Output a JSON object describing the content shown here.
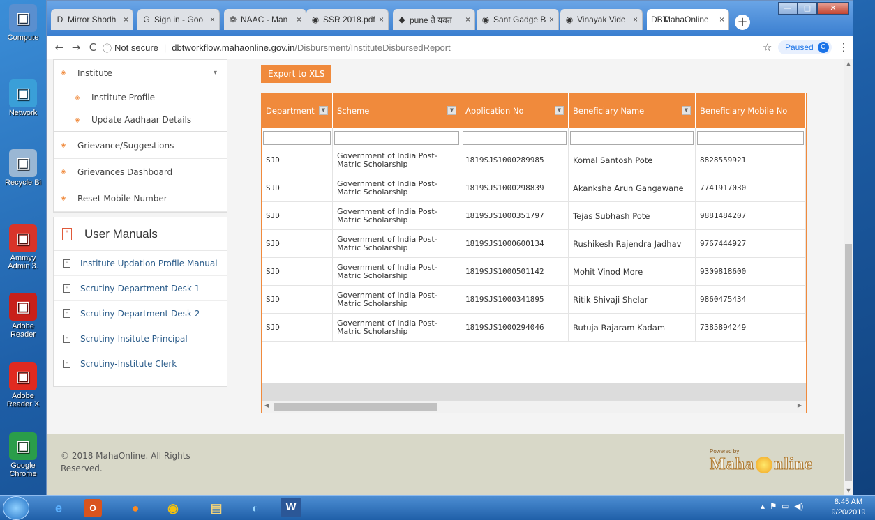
{
  "desktop": {
    "icons": [
      {
        "label": "Compute",
        "icon": "computer-icon",
        "color": "#5a8fcf"
      },
      {
        "label": "Network",
        "icon": "network-icon",
        "color": "#3a9fd8"
      },
      {
        "label": "Recycle Bi",
        "icon": "recycle-bin-icon",
        "color": "#9ab7d4"
      },
      {
        "label": "Ammyy Admin 3.",
        "icon": "ammyy-admin-icon",
        "color": "#d8342a"
      },
      {
        "label": "Adobe Reader",
        "icon": "adobe-reader-icon",
        "color": "#c8201a"
      },
      {
        "label": "Adobe Reader X",
        "icon": "adobe-reader-x-icon",
        "color": "#e02a20"
      },
      {
        "label": "Google Chrome",
        "icon": "chrome-icon",
        "color": "#2a9d4a"
      }
    ]
  },
  "browser": {
    "tabs": [
      {
        "label": "Mirror Shodh",
        "icon": "D"
      },
      {
        "label": "Sign in - Goo",
        "icon": "G"
      },
      {
        "label": "NAAC - Man",
        "icon": "❁"
      },
      {
        "label": "SSR 2018.pdf",
        "icon": "◉"
      },
      {
        "label": "pune ते यवत",
        "icon": "◆"
      },
      {
        "label": "Sant Gadge B",
        "icon": "◉"
      },
      {
        "label": "Vinayak Vide",
        "icon": "◉"
      },
      {
        "label": "MahaOnline",
        "icon": "DBT"
      }
    ],
    "tab_close": "×",
    "new_tab": "+",
    "nav": {
      "back": "←",
      "forward": "→",
      "reload": "C"
    },
    "address": {
      "security": "Not secure",
      "host": "dbtworkflow.mahaonline.gov.in",
      "path": "/Disbursment/InstituteDisbursedReport"
    },
    "star": "☆",
    "profile": {
      "label": "Paused",
      "initial": "C"
    },
    "menu": "⋮"
  },
  "sidebar": {
    "institute": "Institute",
    "institute_profile": "Institute Profile",
    "update_aadhaar": "Update Aadhaar Details",
    "grievance": "Grievance/Suggestions",
    "grievances_dashboard": "Grievances Dashboard",
    "reset_mobile": "Reset Mobile Number",
    "manuals_title": "User Manuals",
    "manuals": [
      "Institute Updation Profile Manual",
      "Scrutiny-Department Desk 1",
      "Scrutiny-Department Desk 2",
      "Scrutiny-Insitute Principal",
      "Scrutiny-Institute Clerk"
    ]
  },
  "main": {
    "export_label": "Export to XLS",
    "columns": [
      "Department",
      "Scheme",
      "Application No",
      "Beneficiary Name",
      "Beneficiary Mobile No"
    ],
    "rows": [
      {
        "dept": "SJD",
        "scheme": "Government of India Post-Matric Scholarship",
        "app": "1819SJS1000289985",
        "name": "Komal Santosh Pote",
        "mobile": "8828559921"
      },
      {
        "dept": "SJD",
        "scheme": "Government of India Post-Matric Scholarship",
        "app": "1819SJS1000298839",
        "name": "Akanksha Arun Gangawane",
        "mobile": "7741917030"
      },
      {
        "dept": "SJD",
        "scheme": "Government of India Post-Matric Scholarship",
        "app": "1819SJS1000351797",
        "name": "Tejas Subhash Pote",
        "mobile": "9881484207"
      },
      {
        "dept": "SJD",
        "scheme": "Government of India Post-Matric Scholarship",
        "app": "1819SJS1000600134",
        "name": "Rushikesh Rajendra Jadhav",
        "mobile": "9767444927"
      },
      {
        "dept": "SJD",
        "scheme": "Government of India Post-Matric Scholarship",
        "app": "1819SJS1000501142",
        "name": "Mohit Vinod More",
        "mobile": "9309818600"
      },
      {
        "dept": "SJD",
        "scheme": "Government of India Post-Matric Scholarship",
        "app": "1819SJS1000341895",
        "name": "Ritik Shivaji Shelar",
        "mobile": "9860475434"
      },
      {
        "dept": "SJD",
        "scheme": "Government of India Post-Matric Scholarship",
        "app": "1819SJS1000294046",
        "name": "Rutuja Rajaram Kadam",
        "mobile": "7385894249"
      }
    ]
  },
  "footer": {
    "copyright": "© 2018 MahaOnline. All Rights Reserved.",
    "powered_by": "Powered by",
    "logo_left": "Maha",
    "logo_right": "nline"
  },
  "taskbar": {
    "time": "8:45 AM",
    "date": "9/20/2019"
  },
  "colors": {
    "accent": "#f08a3c",
    "link": "#2b5c8a",
    "footer_bg": "#d8d8c8"
  }
}
